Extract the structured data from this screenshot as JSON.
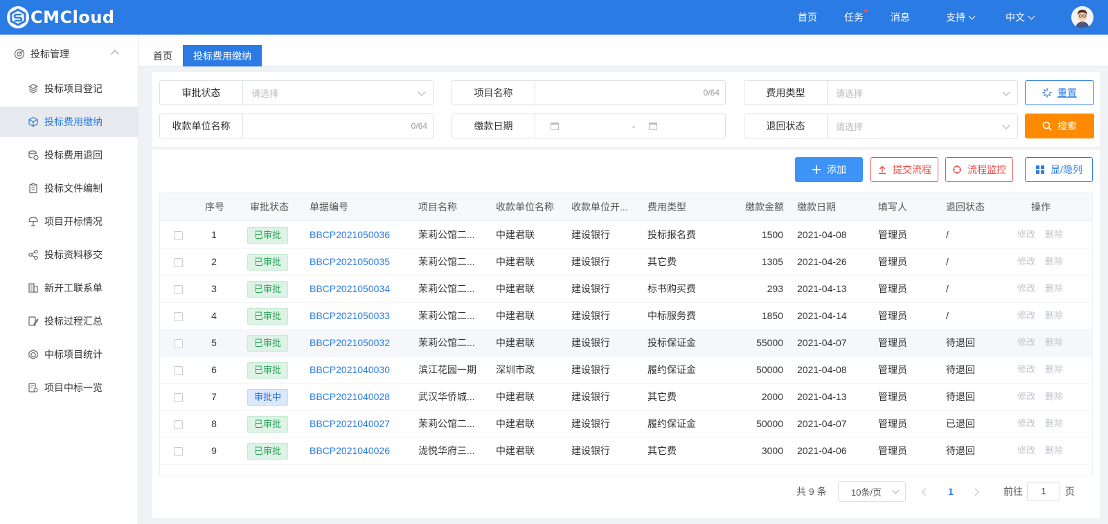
{
  "header": {
    "logo_text": "CMCloud",
    "nav": [
      {
        "label": "首页"
      },
      {
        "label": "任务",
        "has_dot": true
      },
      {
        "label": "消息"
      },
      {
        "label": "支持",
        "has_dropdown": true
      },
      {
        "label": "中文",
        "has_dropdown": true
      }
    ],
    "brand_color": "#2b7be5"
  },
  "sidebar": {
    "group_label": "投标管理",
    "items": [
      {
        "label": "投标项目登记",
        "icon": "layers-icon"
      },
      {
        "label": "投标费用缴纳",
        "icon": "cube-icon",
        "active": true
      },
      {
        "label": "投标费用退回",
        "icon": "coins-return-icon"
      },
      {
        "label": "投标文件编制",
        "icon": "clipboard-icon"
      },
      {
        "label": "项目开标情况",
        "icon": "open-bid-icon"
      },
      {
        "label": "投标资料移交",
        "icon": "share-nodes-icon"
      },
      {
        "label": "新开工联系单",
        "icon": "building-icon"
      },
      {
        "label": "投标过程汇总",
        "icon": "edit-doc-icon"
      },
      {
        "label": "中标项目统计",
        "icon": "hexagon-icon"
      },
      {
        "label": "项目中标一览",
        "icon": "doc-settings-icon"
      }
    ]
  },
  "tabs": [
    {
      "label": "首页"
    },
    {
      "label": "投标费用缴纳",
      "active": true
    }
  ],
  "filters": {
    "approval_status": {
      "label": "审批状态",
      "placeholder": "请选择"
    },
    "project_name": {
      "label": "项目名称",
      "count": "0/64"
    },
    "fee_type": {
      "label": "费用类型",
      "placeholder": "请选择"
    },
    "payee_name": {
      "label": "收款单位名称",
      "count": "0/64"
    },
    "pay_date": {
      "label": "缴款日期",
      "separator": "-"
    },
    "return_status": {
      "label": "退回状态",
      "placeholder": "请选择"
    },
    "reset_label": "重置",
    "search_label": "搜索"
  },
  "toolbar": {
    "add_label": "添加",
    "submit_flow_label": "提交流程",
    "flow_monitor_label": "流程监控",
    "columns_label": "显/隐列"
  },
  "table": {
    "headers": [
      "序号",
      "审批状态",
      "单据编号",
      "项目名称",
      "收款单位名称",
      "收款单位开...",
      "费用类型",
      "缴款金额",
      "缴款日期",
      "填写人",
      "退回状态",
      "操作"
    ],
    "rows": [
      {
        "no": "1",
        "status": "已审批",
        "status_kind": "approved",
        "code": "BBCP2021050036",
        "project": "茉莉公馆二...",
        "payee": "中建君联",
        "bank": "建设银行",
        "fee_type": "投标报名费",
        "amount": "1500",
        "date": "2021-04-08",
        "writer": "管理员",
        "return_status": "/",
        "edit": "修改",
        "delete": "删除"
      },
      {
        "no": "2",
        "status": "已审批",
        "status_kind": "approved",
        "code": "BBCP2021050035",
        "project": "茉莉公馆二...",
        "payee": "中建君联",
        "bank": "建设银行",
        "fee_type": "其它费",
        "amount": "1305",
        "date": "2021-04-26",
        "writer": "管理员",
        "return_status": "/",
        "edit": "修改",
        "delete": "删除"
      },
      {
        "no": "3",
        "status": "已审批",
        "status_kind": "approved",
        "code": "BBCP2021050034",
        "project": "茉莉公馆二...",
        "payee": "中建君联",
        "bank": "建设银行",
        "fee_type": "标书购买费",
        "amount": "293",
        "date": "2021-04-13",
        "writer": "管理员",
        "return_status": "/",
        "edit": "修改",
        "delete": "删除"
      },
      {
        "no": "4",
        "status": "已审批",
        "status_kind": "approved",
        "code": "BBCP2021050033",
        "project": "茉莉公馆二...",
        "payee": "中建君联",
        "bank": "建设银行",
        "fee_type": "中标服务费",
        "amount": "1850",
        "date": "2021-04-14",
        "writer": "管理员",
        "return_status": "/",
        "edit": "修改",
        "delete": "删除"
      },
      {
        "no": "5",
        "status": "已审批",
        "status_kind": "approved",
        "code": "BBCP2021050032",
        "project": "茉莉公馆二...",
        "payee": "中建君联",
        "bank": "建设银行",
        "fee_type": "投标保证金",
        "amount": "55000",
        "date": "2021-04-07",
        "writer": "管理员",
        "return_status": "待退回",
        "edit": "修改",
        "delete": "删除",
        "highlight": true
      },
      {
        "no": "6",
        "status": "已审批",
        "status_kind": "approved",
        "code": "BBCP2021040030",
        "project": "滨江花园一期",
        "payee": "深圳市政",
        "bank": "建设银行",
        "fee_type": "履约保证金",
        "amount": "50000",
        "date": "2021-04-08",
        "writer": "管理员",
        "return_status": "待退回",
        "edit": "修改",
        "delete": "删除"
      },
      {
        "no": "7",
        "status": "审批中",
        "status_kind": "pending",
        "code": "BBCP2021040028",
        "project": "武汉华侨城...",
        "payee": "中建君联",
        "bank": "建设银行",
        "fee_type": "其它费",
        "amount": "2000",
        "date": "2021-04-13",
        "writer": "管理员",
        "return_status": "待退回",
        "edit": "修改",
        "delete": "删除"
      },
      {
        "no": "8",
        "status": "已审批",
        "status_kind": "approved",
        "code": "BBCP2021040027",
        "project": "茉莉公馆二...",
        "payee": "中建君联",
        "bank": "建设银行",
        "fee_type": "履约保证金",
        "amount": "50000",
        "date": "2021-04-07",
        "writer": "管理员",
        "return_status": "已退回",
        "edit": "修改",
        "delete": "删除"
      },
      {
        "no": "9",
        "status": "已审批",
        "status_kind": "approved",
        "code": "BBCP2021040026",
        "project": "泷悦华府三...",
        "payee": "中建君联",
        "bank": "建设银行",
        "fee_type": "其它费",
        "amount": "3000",
        "date": "2021-04-06",
        "writer": "管理员",
        "return_status": "待退回",
        "edit": "修改",
        "delete": "删除"
      }
    ]
  },
  "pagination": {
    "total_text": "共 9 条",
    "page_size": "10条/页",
    "current_page": "1",
    "goto_label": "前往",
    "goto_value": "1",
    "page_unit": "页"
  }
}
